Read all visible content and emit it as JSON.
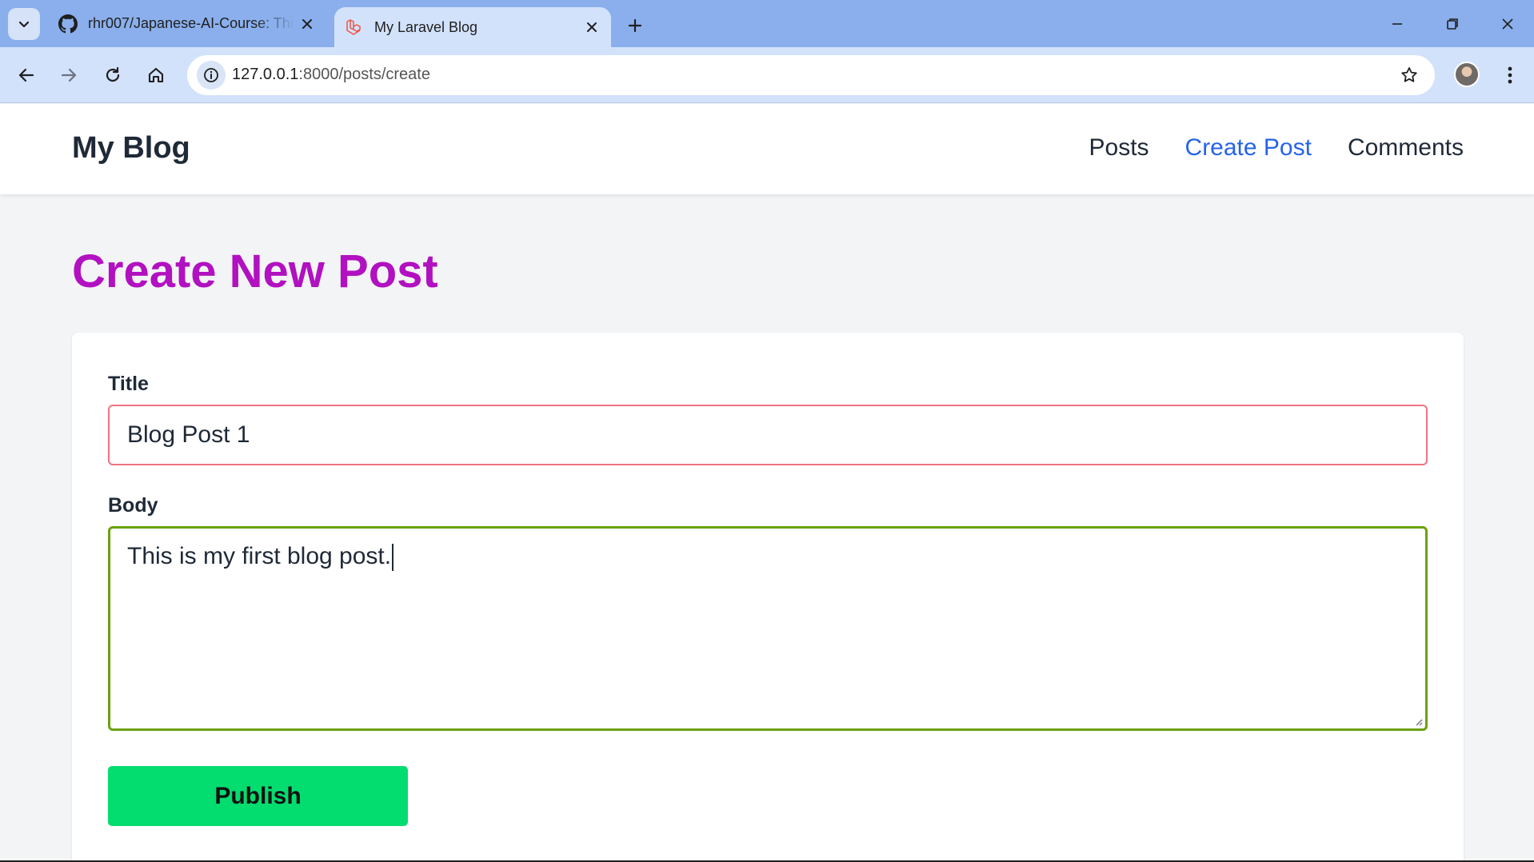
{
  "browser": {
    "tabs": [
      {
        "title": "rhr007/Japanese-AI-Course: Thi",
        "favicon": "github-icon",
        "active": false
      },
      {
        "title": "My Laravel Blog",
        "favicon": "laravel-icon",
        "active": true
      }
    ],
    "address": {
      "host": "127.0.0.1",
      "path": ":8000/posts/create"
    }
  },
  "site": {
    "brand": "My Blog",
    "nav": [
      {
        "label": "Posts",
        "active": false
      },
      {
        "label": "Create Post",
        "active": true
      },
      {
        "label": "Comments",
        "active": false
      }
    ]
  },
  "form": {
    "heading": "Create New Post",
    "title_label": "Title",
    "title_value": "Blog Post 1",
    "body_label": "Body",
    "body_value": "This is my first blog post.",
    "submit_label": "Publish"
  },
  "colors": {
    "heading": "#b111c0",
    "nav_active": "#2563eb",
    "title_border": "#f2727f",
    "body_border": "#6aa10f",
    "publish_bg": "#03dc6f"
  }
}
